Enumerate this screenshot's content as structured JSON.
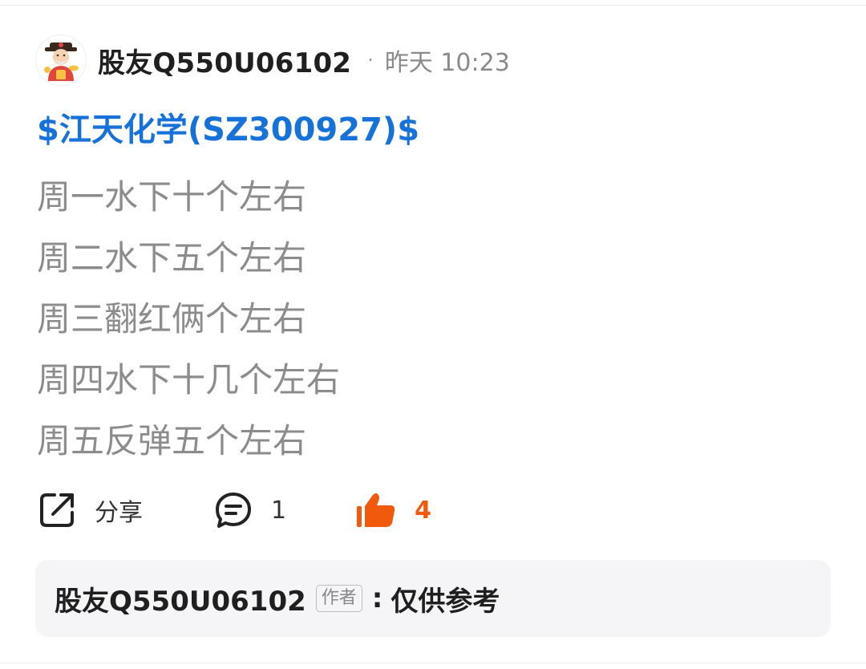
{
  "post": {
    "author": "股友Q550U06102",
    "separator": "·",
    "timestamp": "昨天 10:23",
    "stock_link": "$江天化学(SZ300927)$",
    "lines": [
      "周一水下十个左右",
      "周二水下五个左右",
      "周三翻红俩个左右",
      "周四水下十几个左右",
      "周五反弹五个左右"
    ]
  },
  "actions": {
    "share_label": "分享",
    "comment_count": "1",
    "like_count": "4"
  },
  "reply": {
    "user": "股友Q550U06102",
    "badge": "作者",
    "separator": ":",
    "text": "仅供参考"
  },
  "colors": {
    "link": "#1672d8",
    "like": "#f15a0c",
    "body_text": "#8c8c8c"
  },
  "icons": {
    "avatar": "fortune-god-avatar",
    "share": "share-icon",
    "comment": "comment-icon",
    "like": "thumbs-up-icon"
  }
}
